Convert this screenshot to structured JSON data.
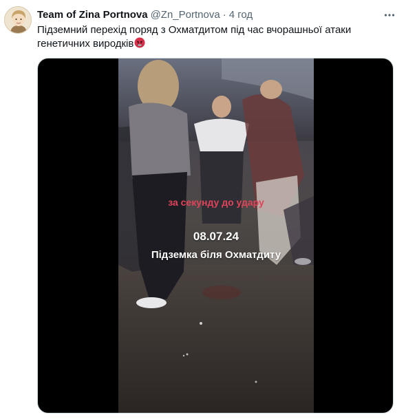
{
  "tweet": {
    "author_name": "Team of Zina Portnova",
    "author_handle": "@Zn_Portnova",
    "separator": "·",
    "time": "4 год",
    "more_icon": "ellipsis-icon",
    "text": "Підземний перехід поряд з Охматдитом під час вчорашньої атаки генетичних виродків",
    "emoji": "angry-face-emoji"
  },
  "media": {
    "overlay_red": "за секунду до удару",
    "overlay_date": "08.07.24",
    "overlay_place": "Підземка біля Охматдиту"
  },
  "colors": {
    "text_primary": "#0f1419",
    "text_secondary": "#536471",
    "media_border": "#cfd9de",
    "overlay_red": "#e0445a"
  }
}
